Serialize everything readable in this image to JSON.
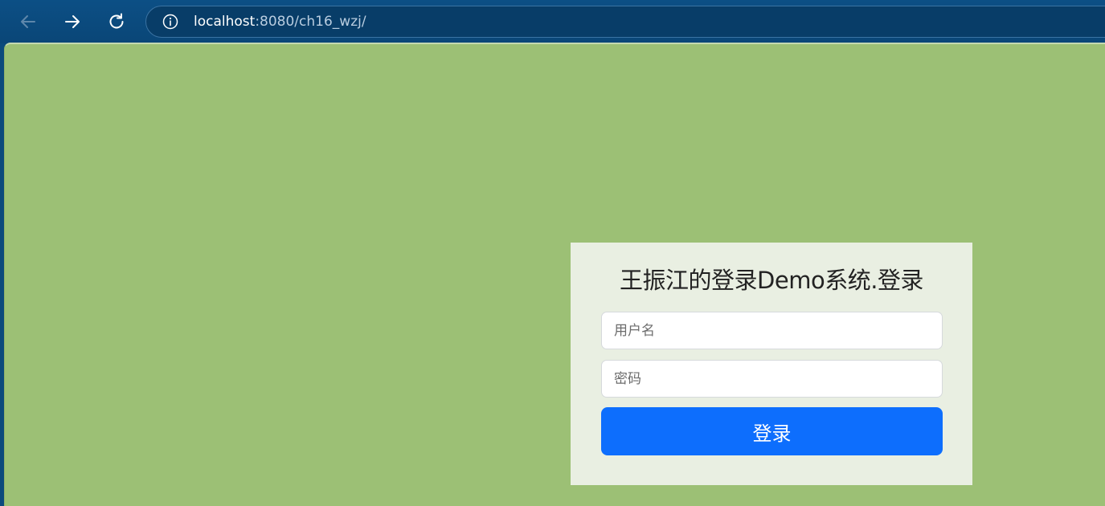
{
  "browser": {
    "url_host": "localhost",
    "url_rest": ":8080/ch16_wzj/",
    "icons": {
      "back": "arrow-left-icon",
      "forward": "arrow-right-icon",
      "reload": "reload-icon",
      "info": "info-icon"
    }
  },
  "page": {
    "background_color": "#9cc075",
    "login": {
      "title": "王振江的登录Demo系统.登录",
      "username_placeholder": "用户名",
      "password_placeholder": "密码",
      "submit_label": "登录",
      "button_color": "#0d6efd"
    }
  }
}
